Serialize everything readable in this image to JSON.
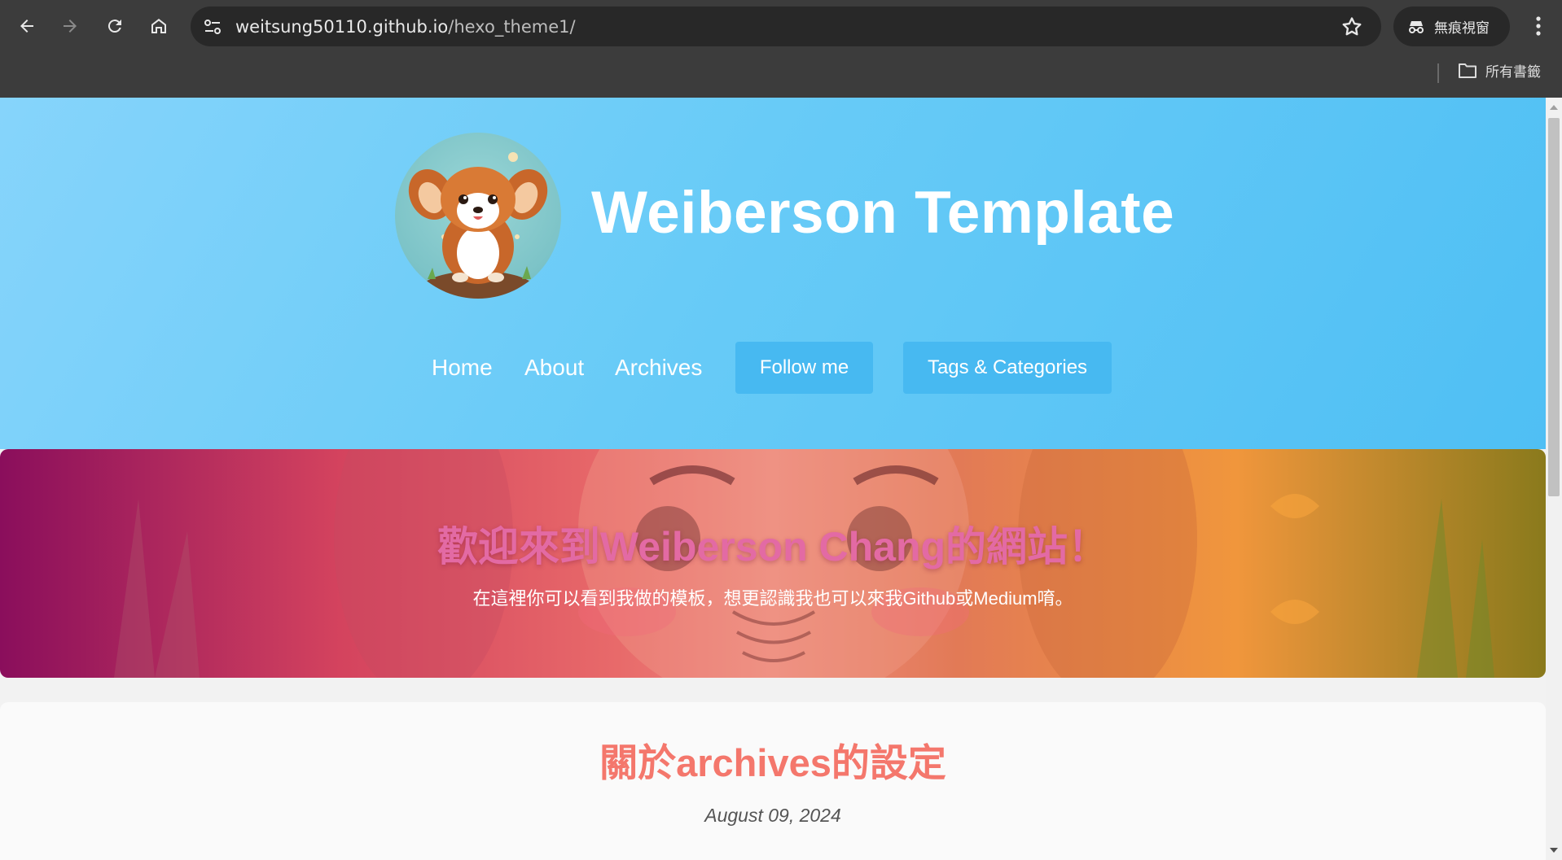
{
  "browser": {
    "url_host": "weitsung50110.github.io",
    "url_path": "/hexo_theme1/",
    "incognito_label": "無痕視窗",
    "bookmarks_all_label": "所有書籤",
    "icons": [
      "back-icon",
      "forward-icon",
      "reload-icon",
      "home-icon",
      "site-info-icon",
      "star-icon",
      "incognito-icon",
      "more-menu-icon",
      "folder-icon"
    ]
  },
  "header": {
    "site_title": "Weiberson Template",
    "nav": {
      "home": "Home",
      "about": "About",
      "archives": "Archives",
      "follow": "Follow me",
      "tags": "Tags & Categories"
    }
  },
  "banner": {
    "title": "歡迎來到Weiberson Chang的網站！",
    "subtitle": "在這裡你可以看到我做的模板，想更認識我也可以來我Github或Medium唷。"
  },
  "post": {
    "title": "關於archives的設定",
    "date": "August 09, 2024"
  },
  "colors": {
    "header_gradient_start": "#86d4fb",
    "header_gradient_end": "#4fbff4",
    "nav_pill": "#47b9f1",
    "banner_title": "#e36aa4",
    "post_title": "#f4776c",
    "chrome_bg": "#3c3c3c"
  }
}
